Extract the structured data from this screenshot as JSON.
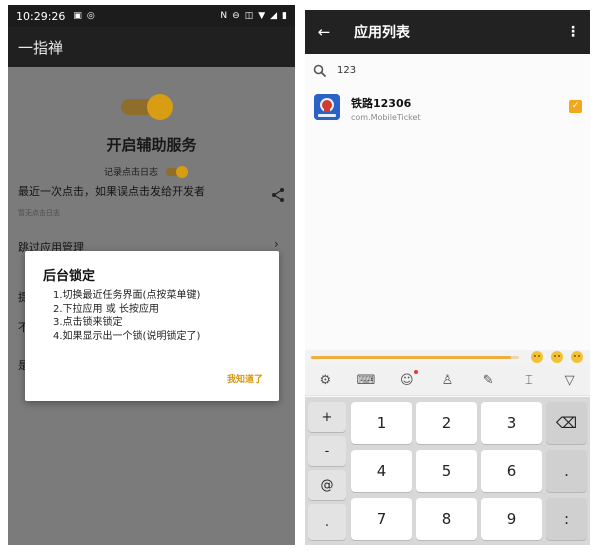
{
  "left_screen": {
    "status": {
      "time": "10:29:26"
    },
    "app_title": "一指禅",
    "service_title": "开启辅助服务",
    "record_log_label": "记录点击日志",
    "recent_click_text": "最近一次点击，如果误点击发给开发者",
    "no_log_text": "暂无点击日志",
    "skip_apps_label": "跳过应用管理",
    "dimmed_rows": [
      "提",
      "不",
      "是"
    ],
    "dialog": {
      "title": "后台锁定",
      "steps": [
        "1.切换最近任务界面(点按菜单键)",
        "2.下拉应用 或 长按应用",
        "3.点击锁来锁定",
        "4.如果显示出一个锁(说明锁定了)"
      ],
      "confirm_label": "我知道了"
    }
  },
  "right_screen": {
    "title": "应用列表",
    "search": {
      "value": "123"
    },
    "apps": [
      {
        "name": "铁路12306",
        "package": "com.MobileTicket",
        "checked": true
      }
    ],
    "progress": 0.96,
    "toolbar_icons": [
      "settings-icon",
      "keyboard-icon",
      "emoji-icon",
      "tshirt-icon",
      "handwriting-icon",
      "cursor-icon",
      "collapse-icon"
    ],
    "keypad": {
      "symbols": [
        "+",
        "-",
        "@",
        "."
      ],
      "digits": [
        "1",
        "2",
        "3",
        "4",
        "5",
        "6",
        "7",
        "8",
        "9"
      ],
      "side": [
        "⌫",
        ".",
        ":"
      ]
    },
    "colors": {
      "accent": "#f2a81c",
      "appbar": "#222222"
    }
  }
}
